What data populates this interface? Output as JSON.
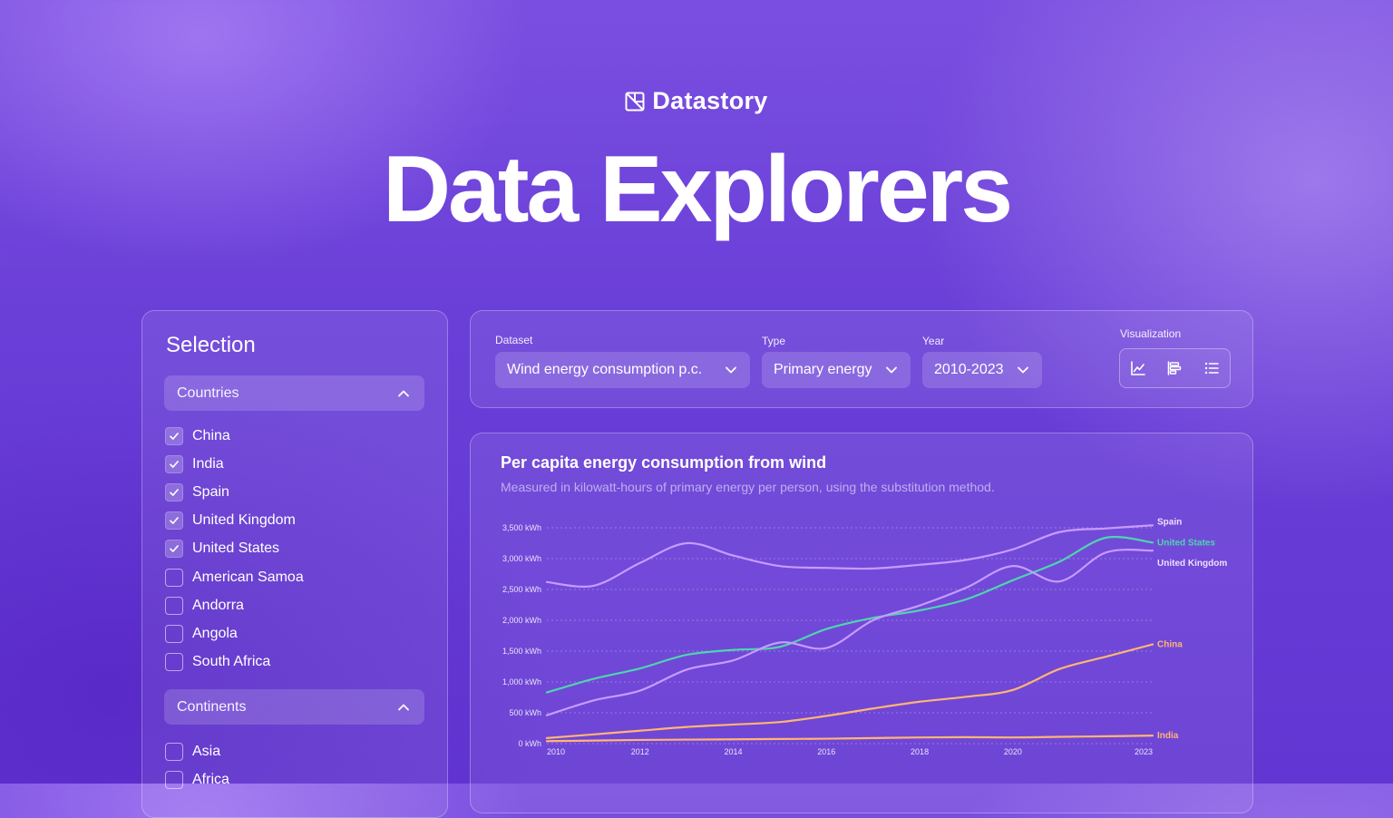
{
  "brand": {
    "name": "Datastory"
  },
  "hero": {
    "title": "Data Explorers"
  },
  "sidebar": {
    "title": "Selection",
    "countries_label": "Countries",
    "continents_label": "Continents",
    "countries": [
      {
        "label": "China",
        "checked": true
      },
      {
        "label": "India",
        "checked": true
      },
      {
        "label": "Spain",
        "checked": true
      },
      {
        "label": "United Kingdom",
        "checked": true
      },
      {
        "label": "United States",
        "checked": true
      },
      {
        "label": "American Samoa",
        "checked": false
      },
      {
        "label": "Andorra",
        "checked": false
      },
      {
        "label": "Angola",
        "checked": false
      },
      {
        "label": "South Africa",
        "checked": false
      }
    ],
    "continents": [
      {
        "label": "Asia",
        "checked": false
      },
      {
        "label": "Africa",
        "checked": false
      }
    ]
  },
  "controls": {
    "dataset_label": "Dataset",
    "dataset_value": "Wind energy consumption p.c.",
    "type_label": "Type",
    "type_value": "Primary energy",
    "year_label": "Year",
    "year_value": "2010-2023",
    "viz_label": "Visualization",
    "viz_options": [
      "line-chart-icon",
      "bar-chart-icon",
      "list-icon"
    ],
    "viz_active": 0
  },
  "colors": {
    "spain": "#c79bff",
    "united_states": "#4fd4b0",
    "united_kingdom": "#c79bff",
    "china": "#ffb574",
    "india": "#ffb574"
  },
  "chart_data": {
    "type": "line",
    "title": "Per capita energy consumption from wind",
    "subtitle": "Measured in kilowatt-hours of primary energy per person, using the substitution method.",
    "xlabel": "",
    "ylabel": "",
    "ylim": [
      0,
      3500
    ],
    "xlim": [
      2010,
      2023
    ],
    "y_ticks": [
      0,
      500,
      1000,
      1500,
      2000,
      2500,
      3000,
      3500
    ],
    "y_tick_labels": [
      "0 kWh",
      "500 kWh",
      "1,000 kWh",
      "1,500 kWh",
      "2,000 kWh",
      "2,500 kWh",
      "3,000 kWh",
      "3,500 kWh"
    ],
    "x_ticks": [
      2010,
      2012,
      2014,
      2016,
      2018,
      2020,
      2023
    ],
    "grid": true,
    "legend": "end-labels",
    "x": [
      2010,
      2011,
      2012,
      2013,
      2014,
      2015,
      2016,
      2017,
      2018,
      2019,
      2020,
      2021,
      2022,
      2023
    ],
    "series": [
      {
        "name": "Spain",
        "color_key": "spain",
        "values": [
          2620,
          2560,
          2930,
          3250,
          3050,
          2880,
          2850,
          2840,
          2900,
          2980,
          3150,
          3430,
          3490,
          3540
        ]
      },
      {
        "name": "United States",
        "color_key": "united_states",
        "values": [
          830,
          1050,
          1220,
          1440,
          1520,
          1570,
          1860,
          2040,
          2160,
          2340,
          2650,
          2950,
          3340,
          3260
        ]
      },
      {
        "name": "United Kingdom",
        "color_key": "united_kingdom",
        "values": [
          460,
          700,
          860,
          1200,
          1350,
          1640,
          1550,
          2000,
          2240,
          2530,
          2880,
          2630,
          3100,
          3130
        ]
      },
      {
        "name": "China",
        "color_key": "china",
        "values": [
          90,
          150,
          210,
          270,
          310,
          350,
          450,
          570,
          680,
          760,
          870,
          1210,
          1410,
          1610
        ]
      },
      {
        "name": "India",
        "color_key": "india",
        "values": [
          40,
          50,
          60,
          65,
          70,
          75,
          80,
          90,
          100,
          105,
          100,
          110,
          120,
          130
        ]
      }
    ]
  }
}
